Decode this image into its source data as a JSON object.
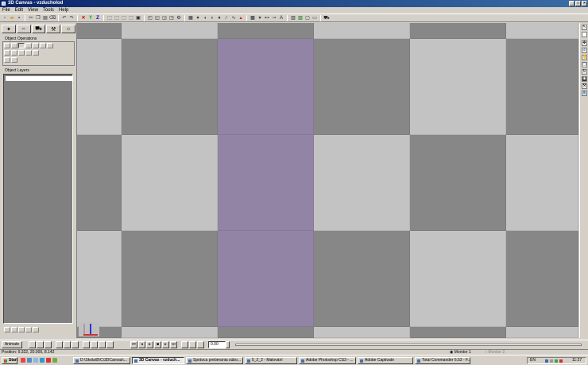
{
  "window": {
    "title": "3D Canvas - vzducholod"
  },
  "menu": [
    "File",
    "Edit",
    "View",
    "Tools",
    "Help"
  ],
  "left_panel": {
    "ops_label": "Object Operations",
    "layers_label": "Object Layers"
  },
  "viewport": {
    "colors": {
      "light": "#c3c3c3",
      "dark": "#878787",
      "purple": "#9184a4"
    }
  },
  "anim": {
    "animate_label": "Animate",
    "time_value": "0.00"
  },
  "status": {
    "position": "Position: 9.322, 20.000, 8.142",
    "monitor1": "Monitor 1",
    "monitor2": "Monitor 2"
  },
  "taskbar": {
    "start": "Start",
    "tasks": [
      "D:\\Skola\\B\\C\\3DCanvas\\...",
      "3D Canvas - vzduch...",
      "Správca preberania súbo...",
      "5_2_2 - Malování",
      "Adobe Photoshop CS3 - ...",
      "Adobe Captivate",
      "Total Commander 6.53 - F..."
    ],
    "lang": "EN",
    "clock": "11:27"
  }
}
